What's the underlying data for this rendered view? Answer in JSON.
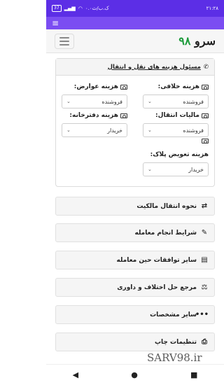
{
  "status": {
    "time": "۲۱:۲۸",
    "speed": "۰.۰ک.ب/ث",
    "battery": "37"
  },
  "app": {
    "brand_text": "سرو",
    "brand_num": "۹۸"
  },
  "card": {
    "title": "مسئول هزینه های نقل و انتقال",
    "fields": [
      {
        "label": "هزینه خلافی:",
        "value": "فروشنده"
      },
      {
        "label": "هزینه عوارض:",
        "value": "فروشنده"
      },
      {
        "label": "مالیات انتقال:",
        "value": "فروشنده"
      },
      {
        "label": "هزینه دفترخانه:",
        "value": "خریدار"
      },
      {
        "label": "هزینه تعویض پلاک:",
        "value": "خریدار"
      }
    ]
  },
  "sections": [
    {
      "label": "نحوه انتقال مالکیت",
      "icon": "transfer-icon"
    },
    {
      "label": "شرایط انجام معامله",
      "icon": "edit-icon"
    },
    {
      "label": "سایر توافقات حین معامله",
      "icon": "document-icon"
    },
    {
      "label": "مرجع حل اختلاف و داوری",
      "icon": "scale-icon"
    },
    {
      "label": "سایر مشخصات",
      "icon": "more-icon"
    },
    {
      "label": "تنظیمات چاپ",
      "icon": "print-icon"
    }
  ],
  "watermark": "SARV98.ir",
  "nav": {
    "back": "◀",
    "home": "●",
    "recents": "■"
  }
}
